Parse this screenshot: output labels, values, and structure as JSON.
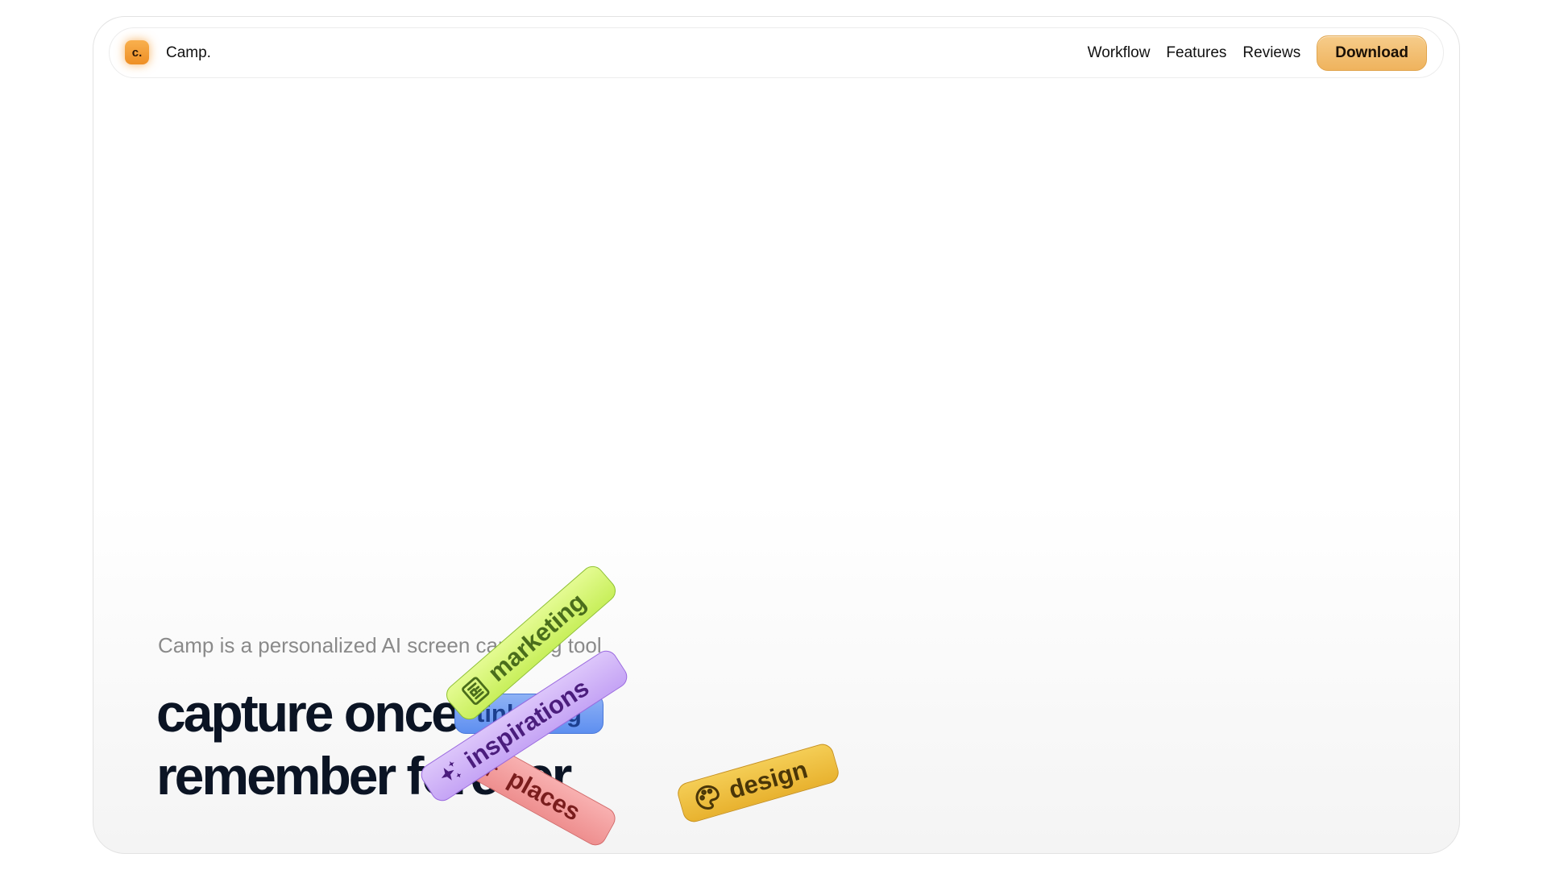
{
  "brand": {
    "logo_mark": "c.",
    "name": "Camp."
  },
  "nav": {
    "links": [
      "Workflow",
      "Features",
      "Reviews"
    ],
    "download_label": "Download"
  },
  "hero": {
    "tagline": "Camp is a personalized AI screen capturing tool",
    "headline_line1": "capture once",
    "headline_line2": "remember forever"
  },
  "tags": {
    "marketing": {
      "label": "marketing",
      "icon": "newspaper-icon"
    },
    "blue": {
      "label": "tinkering",
      "icon": "none"
    },
    "inspirations": {
      "label": "inspirations",
      "icon": "sparkles-icon"
    },
    "places": {
      "label": "places",
      "icon": "pin-icon"
    },
    "design": {
      "label": "design",
      "icon": "palette-icon"
    }
  },
  "colors": {
    "accent": "#efb35d",
    "headline": "#0b1424",
    "tag_marketing": "#c8ef5b",
    "tag_blue": "#5e8ff0",
    "tag_inspirations": "#c5a4f5",
    "tag_places": "#ee8f8f",
    "tag_design": "#e8b22f"
  }
}
